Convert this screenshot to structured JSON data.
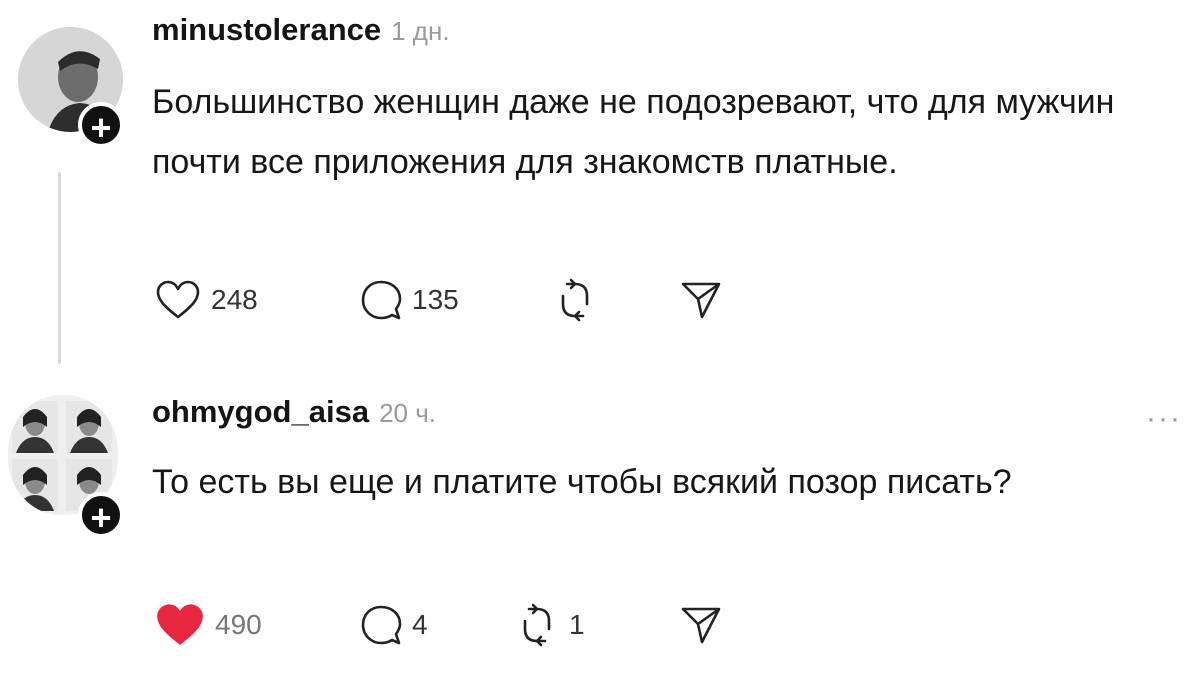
{
  "posts": [
    {
      "username": "minustolerance",
      "time": "1 дн.",
      "text": "Большинство женщин даже не подозревают, что для мужчин почти все приложения для знакомств платные.",
      "likes": "248",
      "comments": "135",
      "reposts": "",
      "liked": false,
      "avatar_icon": "person-photo-icon",
      "follow_icon": "plus-icon"
    },
    {
      "username": "ohmygod_aisa",
      "time": "20 ч.",
      "text": "То есть вы еще и платите чтобы всякий позор писать?",
      "likes": "490",
      "comments": "4",
      "reposts": "1",
      "liked": true,
      "avatar_icon": "photo-collage-icon",
      "follow_icon": "plus-icon",
      "more_label": "···"
    }
  ],
  "colors": {
    "like_active": "#e8263f",
    "text": "#171717",
    "muted": "#9a9a9a",
    "thread_line": "#d9d9d9"
  }
}
